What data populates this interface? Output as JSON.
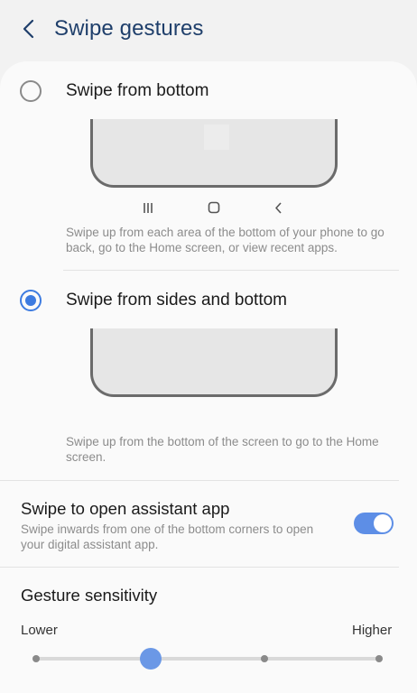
{
  "colors": {
    "accent": "#3d7be0",
    "title_blue": "#1f3f6b",
    "toggle_on": "#5d8ee6"
  },
  "header": {
    "back_icon": "chevron-left-icon",
    "title": "Swipe gestures"
  },
  "options": [
    {
      "label": "Swipe from bottom",
      "selected": false,
      "description": "Swipe up from each area of the bottom of your phone to go back, go to the Home screen, or view recent apps.",
      "nav_icons": [
        "recents-icon",
        "home-icon",
        "back-icon"
      ]
    },
    {
      "label": "Swipe from sides and bottom",
      "selected": true,
      "description": "Swipe up from the bottom of the screen to go to the Home screen."
    }
  ],
  "assistant": {
    "title": "Swipe to open assistant app",
    "description": "Swipe inwards from one of the bottom corners to open your digital assistant app.",
    "enabled": true
  },
  "sensitivity": {
    "title": "Gesture sensitivity",
    "low_label": "Lower",
    "high_label": "Higher",
    "steps": 4,
    "selected_step": 2
  }
}
